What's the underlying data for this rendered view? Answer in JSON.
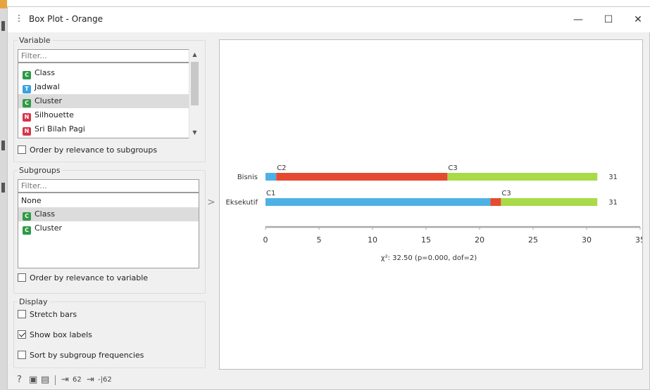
{
  "window": {
    "title": "Box Plot - Orange",
    "buttons": {
      "minimize": "—",
      "maximize": "☐",
      "close": "✕"
    }
  },
  "variable_box": {
    "title": "Variable",
    "filter_placeholder": "Filter...",
    "items": [
      {
        "label": "Class",
        "type_badge": "C",
        "type_color": "#2e9a47",
        "selected": false
      },
      {
        "label": "Jadwal",
        "type_badge": "T",
        "type_color": "#3aa3df",
        "selected": false
      },
      {
        "label": "Cluster",
        "type_badge": "C",
        "type_color": "#2e9a47",
        "selected": true
      },
      {
        "label": "Silhouette",
        "type_badge": "N",
        "type_color": "#d8334a",
        "selected": false
      },
      {
        "label": "Sri Bilah Pagi",
        "type_badge": "N",
        "type_color": "#d8334a",
        "selected": false
      }
    ],
    "order_checkbox": {
      "label": "Order by relevance to subgroups",
      "checked": false
    }
  },
  "subgroups_box": {
    "title": "Subgroups",
    "filter_placeholder": "Filter...",
    "items": [
      {
        "label": "None",
        "type_badge": "",
        "selected": false
      },
      {
        "label": "Class",
        "type_badge": "C",
        "type_color": "#2e9a47",
        "selected": true
      },
      {
        "label": "Cluster",
        "type_badge": "C",
        "type_color": "#2e9a47",
        "selected": false
      }
    ],
    "order_checkbox": {
      "label": "Order by relevance to variable",
      "checked": false
    }
  },
  "display_box": {
    "title": "Display",
    "stretch_bars": {
      "label": "Stretch bars",
      "checked": false
    },
    "show_box_labels": {
      "label": "Show box labels",
      "checked": true
    },
    "sort_by_frequencies": {
      "label": "Sort by subgroup frequencies",
      "checked": false
    }
  },
  "splitter_arrow": ">",
  "status_bar": {
    "input_count": "62",
    "output_count": "-|62"
  },
  "chart_data": {
    "type": "bar",
    "orientation": "horizontal-stacked",
    "categories": [
      "Bisnis",
      "Eksekutif"
    ],
    "segments": [
      [
        {
          "label": "",
          "value": 1,
          "color": "#4db1e6"
        },
        {
          "label": "C2",
          "value": 16,
          "color": "#e44b31"
        },
        {
          "label": "C3",
          "value": 14,
          "color": "#a8db47"
        }
      ],
      [
        {
          "label": "C1",
          "value": 21,
          "color": "#4db1e6"
        },
        {
          "label": "",
          "value": 1,
          "color": "#e44b31"
        },
        {
          "label": "C3",
          "value": 9,
          "color": "#a8db47"
        }
      ]
    ],
    "totals": [
      "31",
      "31"
    ],
    "xlim": [
      0,
      35
    ],
    "xticks": [
      "0",
      "5",
      "10",
      "15",
      "20",
      "25",
      "30",
      "35"
    ],
    "stat_text": "χ²: 32.50 (p=0.000, dof=2)"
  }
}
